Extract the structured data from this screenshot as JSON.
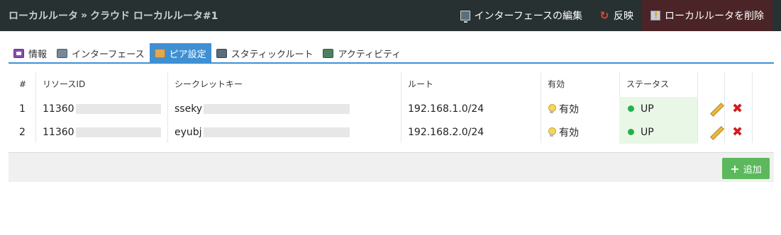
{
  "header": {
    "crumb_parent": "ローカルルータ",
    "crumb_sep": "»",
    "crumb_current": "クラウド ローカルルータ#1",
    "actions": {
      "edit_interface": "インターフェースの編集",
      "apply": "反映",
      "delete_router": "ローカルルータを削除"
    }
  },
  "tabs": [
    {
      "label": "情報",
      "icon": "info-icon"
    },
    {
      "label": "インターフェース",
      "icon": "network-icon"
    },
    {
      "label": "ピア設定",
      "icon": "handshake-icon",
      "active": true
    },
    {
      "label": "スタティックルート",
      "icon": "route-icon"
    },
    {
      "label": "アクティビティ",
      "icon": "activity-icon"
    }
  ],
  "table": {
    "columns": [
      "#",
      "リソースID",
      "シークレットキー",
      "ルート",
      "有効",
      "ステータス"
    ],
    "rows": [
      {
        "num": "1",
        "resource_id": "11360",
        "secret_key": "sseky",
        "route": "192.168.1.0/24",
        "enabled": "有効",
        "status": "UP"
      },
      {
        "num": "2",
        "resource_id": "11360",
        "secret_key": "eyubj",
        "route": "192.168.2.0/24",
        "enabled": "有効",
        "status": "UP"
      }
    ]
  },
  "footer": {
    "add_label": "追加"
  },
  "colors": {
    "topbar": "#283131",
    "accent": "#3f90d3",
    "status_up": "#22b24c",
    "add_button": "#5cb85c",
    "delete_action_bg": "#4a2427"
  }
}
